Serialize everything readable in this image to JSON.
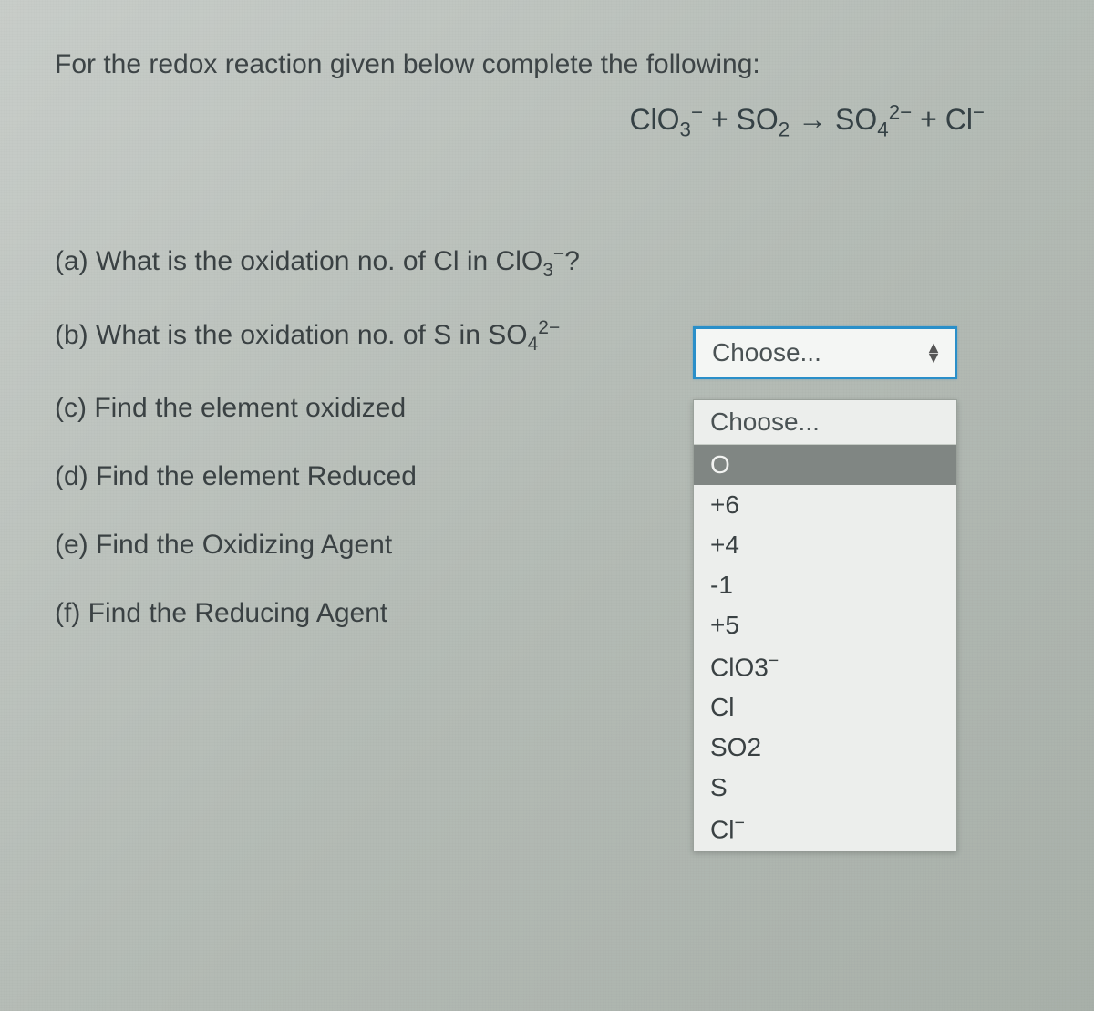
{
  "intro": "For the redox reaction given below complete the following:",
  "equation": {
    "reactant1": "ClO",
    "reactant1_sub": "3",
    "reactant1_sup": "−",
    "plus1": " + ",
    "reactant2": "SO",
    "reactant2_sub": "2",
    "arrow": " → ",
    "product1": "SO",
    "product1_sub": "4",
    "product1_sup": "2−",
    "plus2": " + ",
    "product2": "Cl",
    "product2_sup": "−"
  },
  "questions": {
    "a_prefix": "(a) What is the oxidation no. of Cl in ClO",
    "a_sub": "3",
    "a_sup": "−",
    "a_suffix": "?",
    "b_prefix": "(b) What is the oxidation no. of S in SO",
    "b_sub": "4",
    "b_sup": "2−",
    "c": "(c) Find the element oxidized",
    "d": "(d) Find the element Reduced",
    "e": "(e) Find the Oxidizing Agent",
    "f": "(f) Find the Reducing Agent"
  },
  "select": {
    "placeholder": "Choose..."
  },
  "dropdown": {
    "header": "Choose...",
    "options": [
      "O",
      "+6",
      "+4",
      "-1",
      "+5",
      "ClO3−",
      "Cl",
      "SO2",
      "S",
      "Cl−"
    ],
    "highlighted_index": 0
  }
}
